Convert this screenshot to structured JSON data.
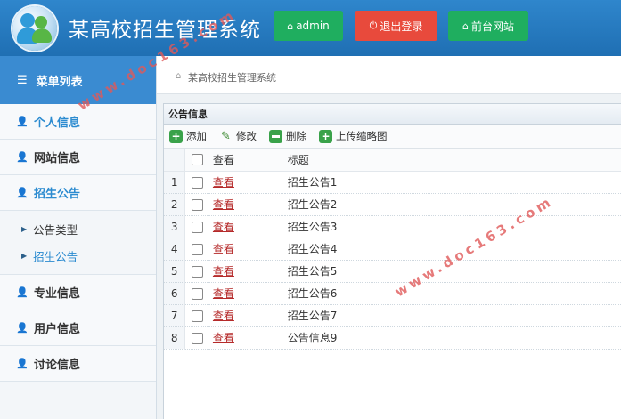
{
  "header": {
    "title": "某高校招生管理系统",
    "admin_label": "admin",
    "logout_label": "退出登录",
    "front_label": "前台网站",
    "admin_icon": "home-icon",
    "logout_icon": "power-icon",
    "front_icon": "home-icon",
    "admin_color": "#1fae5f",
    "logout_color": "#e84a3c",
    "front_color": "#1fae5f"
  },
  "sidebar": {
    "head_label": "菜单列表",
    "head_icon": "list-icon",
    "items": [
      {
        "label": "个人信息",
        "icon": "user-icon",
        "active": true
      },
      {
        "label": "网站信息",
        "icon": "user-icon",
        "active": false
      },
      {
        "label": "招生公告",
        "icon": "user-icon",
        "active": true
      }
    ],
    "submenu": [
      {
        "label": "公告类型",
        "active": false
      },
      {
        "label": "招生公告",
        "active": true
      }
    ],
    "items_after": [
      {
        "label": "专业信息",
        "icon": "user-icon"
      },
      {
        "label": "用户信息",
        "icon": "user-icon"
      },
      {
        "label": "讨论信息",
        "icon": "user-icon"
      }
    ]
  },
  "breadcrumb": {
    "text": "某高校招生管理系统",
    "icon": "home-icon"
  },
  "panel": {
    "title": "公告信息",
    "toolbar": {
      "add_label": "添加",
      "edit_label": "修改",
      "delete_label": "删除",
      "upload_label": "上传缩略图"
    },
    "columns": {
      "view": "查看",
      "title": "标题"
    },
    "rows": [
      {
        "num": "1",
        "view": "查看",
        "title": "招生公告1"
      },
      {
        "num": "2",
        "view": "查看",
        "title": "招生公告2"
      },
      {
        "num": "3",
        "view": "查看",
        "title": "招生公告3"
      },
      {
        "num": "4",
        "view": "查看",
        "title": "招生公告4"
      },
      {
        "num": "5",
        "view": "查看",
        "title": "招生公告5"
      },
      {
        "num": "6",
        "view": "查看",
        "title": "招生公告6"
      },
      {
        "num": "7",
        "view": "查看",
        "title": "招生公告7"
      },
      {
        "num": "8",
        "view": "查看",
        "title": "公告信息9"
      }
    ]
  },
  "watermark": {
    "text1": "www.doc163.com",
    "text2": "www.doc163.com"
  }
}
